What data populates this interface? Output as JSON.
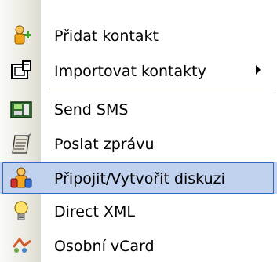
{
  "menu": {
    "items": [
      {
        "label": "Přidat kontakt",
        "icon": "add-contact-icon"
      },
      {
        "label": "Importovat kontakty",
        "icon": "import-contacts-icon",
        "submenu": true
      },
      {
        "label": "Send SMS",
        "icon": "sms-phone-icon"
      },
      {
        "label": "Poslat zprávu",
        "icon": "message-icon"
      },
      {
        "label": "Připojit/Vytvořit diskuzi",
        "icon": "conference-icon",
        "selected": true
      },
      {
        "label": "Direct XML",
        "icon": "lightbulb-icon"
      },
      {
        "label": "Osobní vCard",
        "icon": "vcard-icon"
      }
    ]
  },
  "colors": {
    "selected_background": "#c1d2ee",
    "selected_border": "#316ac5",
    "separator": "#c5c2b8"
  }
}
